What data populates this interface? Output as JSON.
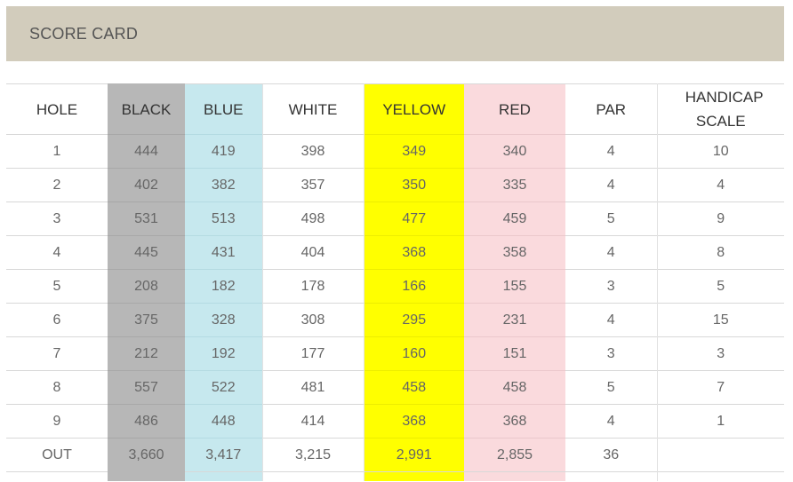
{
  "header": {
    "title": "SCORE CARD"
  },
  "colors": {
    "banner": "#d2ccbc",
    "black": "#b7b7b7",
    "blue": "#c6e8ee",
    "white": "#ffffff",
    "yellow": "#ffff00",
    "red": "#fadadd"
  },
  "table": {
    "columns": [
      "HOLE",
      "BLACK",
      "BLUE",
      "WHITE",
      "YELLOW",
      "RED",
      "PAR",
      "HANDICAP SCALE"
    ],
    "rows": [
      [
        "1",
        "444",
        "419",
        "398",
        "349",
        "340",
        "4",
        "10"
      ],
      [
        "2",
        "402",
        "382",
        "357",
        "350",
        "335",
        "4",
        "4"
      ],
      [
        "3",
        "531",
        "513",
        "498",
        "477",
        "459",
        "5",
        "9"
      ],
      [
        "4",
        "445",
        "431",
        "404",
        "368",
        "358",
        "4",
        "8"
      ],
      [
        "5",
        "208",
        "182",
        "178",
        "166",
        "155",
        "3",
        "5"
      ],
      [
        "6",
        "375",
        "328",
        "308",
        "295",
        "231",
        "4",
        "15"
      ],
      [
        "7",
        "212",
        "192",
        "177",
        "160",
        "151",
        "3",
        "3"
      ],
      [
        "8",
        "557",
        "522",
        "481",
        "458",
        "458",
        "5",
        "7"
      ],
      [
        "9",
        "486",
        "448",
        "414",
        "368",
        "368",
        "4",
        "1"
      ],
      [
        "OUT",
        "3,660",
        "3,417",
        "3,215",
        "2,991",
        "2,855",
        "36",
        ""
      ]
    ]
  }
}
